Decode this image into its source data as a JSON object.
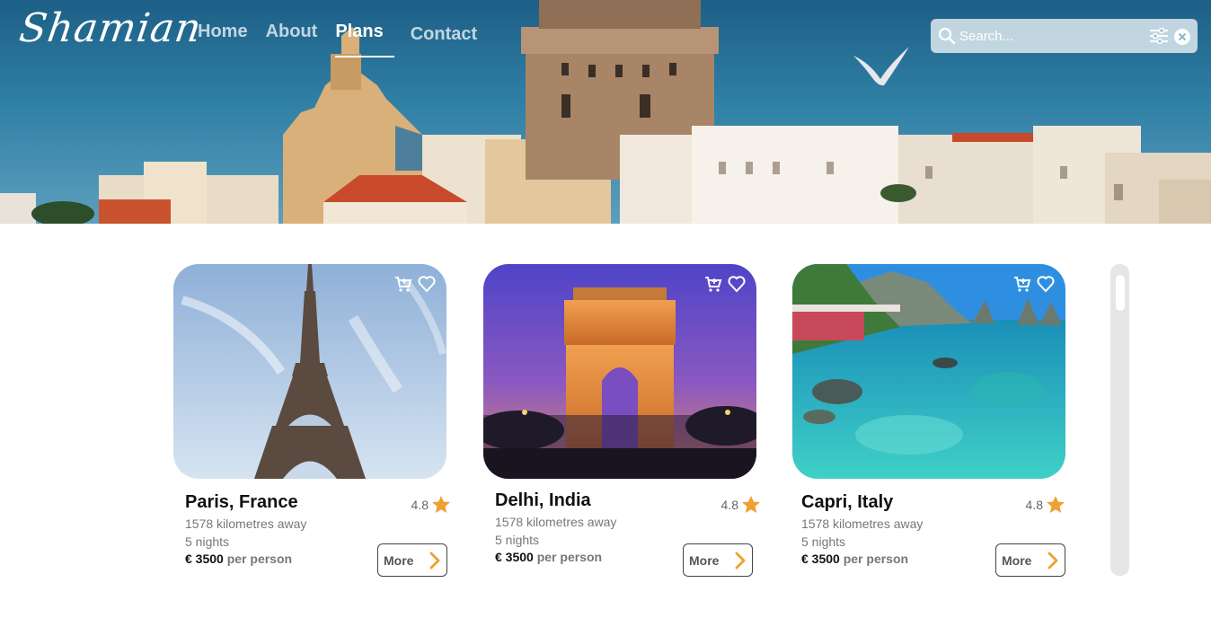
{
  "brand": {
    "logo_text": "Shamian"
  },
  "nav": {
    "items": [
      {
        "label": "Home"
      },
      {
        "label": "About"
      },
      {
        "label": "Plans"
      },
      {
        "label": "Contact"
      }
    ],
    "active": "Plans"
  },
  "search": {
    "placeholder": "Search...",
    "value": ""
  },
  "colors": {
    "accent": "#f0a030",
    "text_dark": "#111111",
    "text_muted": "#777777"
  },
  "cards": [
    {
      "title": "Paris, France",
      "rating": "4.8",
      "distance": "1578 kilometres away",
      "nights": "5 nights",
      "price": "€ 3500",
      "price_suffix": "per person",
      "more_label": "More",
      "image": "eiffel-tower"
    },
    {
      "title": "Delhi, India",
      "rating": "4.8",
      "distance": "1578 kilometres away",
      "nights": "5 nights",
      "price": "€ 3500",
      "price_suffix": "per person",
      "more_label": "More",
      "image": "india-gate"
    },
    {
      "title": "Capri, Italy",
      "rating": "4.8",
      "distance": "1578 kilometres away",
      "nights": "5 nights",
      "price": "€ 3500",
      "price_suffix": "per person",
      "more_label": "More",
      "image": "capri-coast"
    }
  ]
}
